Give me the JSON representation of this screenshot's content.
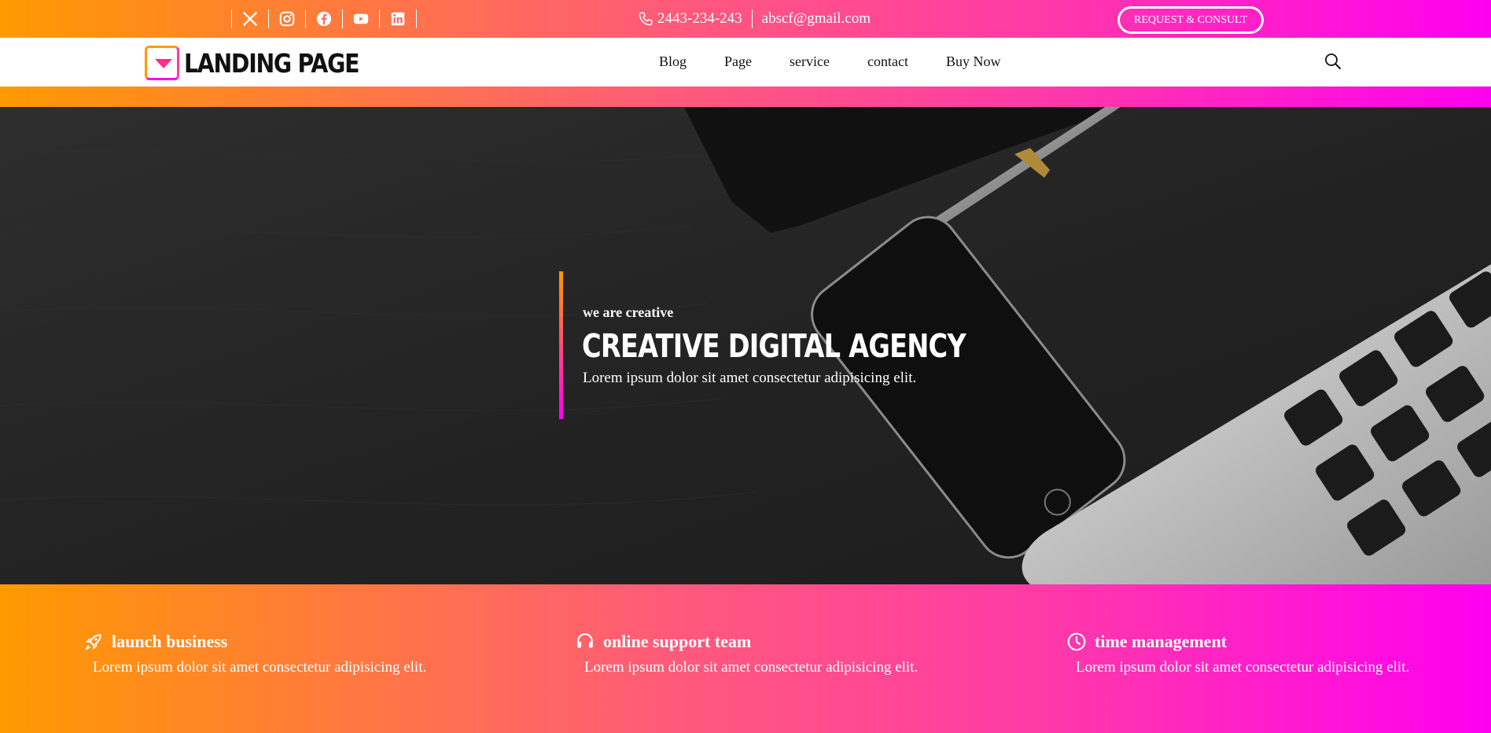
{
  "colors": {
    "gradient_start": "#ff9a00",
    "gradient_end": "#ff00f0",
    "hero_bg": "#262626"
  },
  "topbar": {
    "social_icons": [
      "x-icon",
      "instagram-icon",
      "facebook-icon",
      "youtube-icon",
      "linkedin-icon"
    ],
    "phone": "2443-234-243",
    "email": "abscf@gmail.com",
    "cta_label": "REQUEST & CONSULT"
  },
  "header": {
    "logo_text": "LANDING PAGE",
    "nav": [
      "Blog",
      "Page",
      "service",
      "contact",
      "Buy Now"
    ]
  },
  "hero": {
    "kicker": "we are creative",
    "title": "CREATIVE DIGITAL AGENCY",
    "subtitle": "Lorem ipsum dolor sit amet consectetur adipisicing elit."
  },
  "features": [
    {
      "icon": "rocket-icon",
      "title": "launch business",
      "text": "Lorem ipsum dolor sit amet consectetur adipisicing elit."
    },
    {
      "icon": "headset-icon",
      "title": "online support team",
      "text": "Lorem ipsum dolor sit amet consectetur adipisicing elit."
    },
    {
      "icon": "clock-icon",
      "title": "time management",
      "text": "Lorem ipsum dolor sit amet consectetur adipisicing elit."
    }
  ]
}
